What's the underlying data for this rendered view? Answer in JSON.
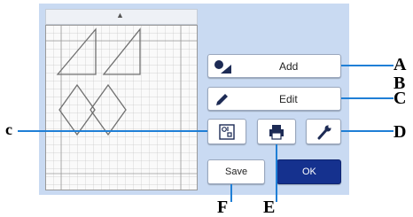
{
  "buttons": {
    "add_label": "Add",
    "edit_label": "Edit",
    "save_label": "Save",
    "ok_label": "OK"
  },
  "callouts": {
    "a": "A",
    "b": "B",
    "c_right": "C",
    "c_left": "c",
    "d": "D",
    "e": "E",
    "f": "F"
  },
  "colors": {
    "panel": "#c9daf2",
    "ok_button": "#15318e",
    "callout_line": "#1f7fd6",
    "icon": "#1d2b55"
  },
  "icons": {
    "add": "shape-add-icon",
    "edit": "pencil-icon",
    "layout": "layout-icon",
    "save_print": "print-icon",
    "settings": "wrench-icon"
  }
}
